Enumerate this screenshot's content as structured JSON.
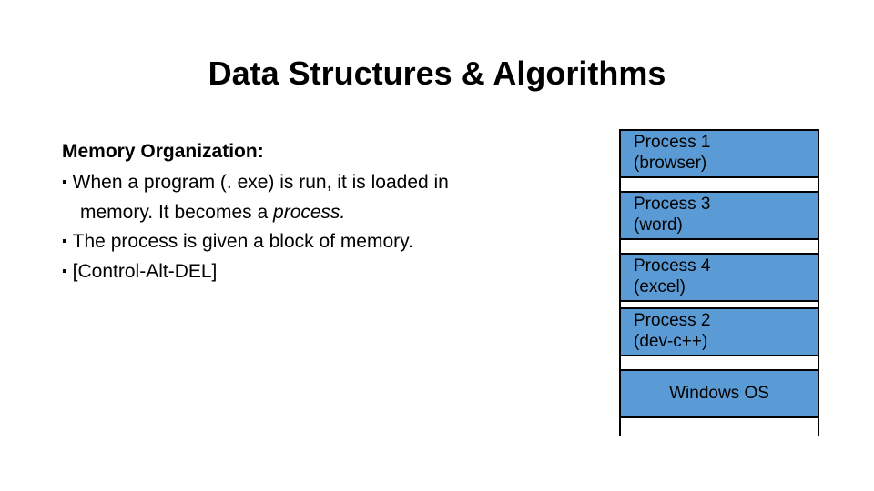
{
  "title": "Data Structures & Algorithms",
  "subheading": "Memory Organization:",
  "bullets": {
    "b1_part1": "When a program (. exe) is run, it is loaded in",
    "b1_part2_plain": "memory. It becomes a ",
    "b1_part2_italic": "process.",
    "b2": "The process is given a block of memory.",
    "b3": "[Control-Alt-DEL]"
  },
  "diagram": {
    "p1_line1": "Process 1",
    "p1_line2": "(browser)",
    "p3_line1": "Process 3",
    "p3_line2": "(word)",
    "p4_line1": "Process 4",
    "p4_line2": "(excel)",
    "p2_line1": "Process 2",
    "p2_line2": "(dev-c++)",
    "os": "Windows OS"
  }
}
